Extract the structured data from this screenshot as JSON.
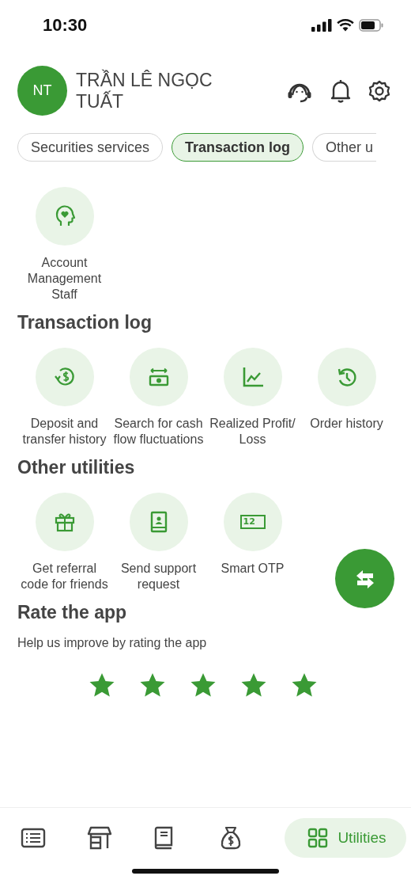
{
  "status_bar": {
    "time": "10:30"
  },
  "profile": {
    "initials": "NT",
    "name": "TRẦN LÊ NGỌC TUẤT"
  },
  "tabs": [
    {
      "label": "Securities services",
      "selected": false
    },
    {
      "label": "Transaction log",
      "selected": true
    },
    {
      "label": "Other u",
      "selected": false
    }
  ],
  "sections": [
    {
      "items": [
        {
          "label": "Account Management Staff"
        }
      ]
    },
    {
      "title": "Transaction log",
      "items": [
        {
          "label": "Deposit and transfer history"
        },
        {
          "label": "Search for cash flow fluctuations"
        },
        {
          "label": "Realized Profit/ Loss"
        },
        {
          "label": "Order history"
        }
      ]
    },
    {
      "title": "Other utilities",
      "items": [
        {
          "label": "Get referral code for friends"
        },
        {
          "label": "Send support request"
        },
        {
          "label": "Smart OTP",
          "icon_text": "12"
        }
      ]
    }
  ],
  "rating": {
    "title": "Rate the app",
    "text": "Help us improve by rating the app",
    "stars": 5
  },
  "bottom_nav": [
    {
      "selected": false
    },
    {
      "selected": false
    },
    {
      "selected": false
    },
    {
      "selected": false
    },
    {
      "label": "Utilities",
      "selected": true
    }
  ]
}
